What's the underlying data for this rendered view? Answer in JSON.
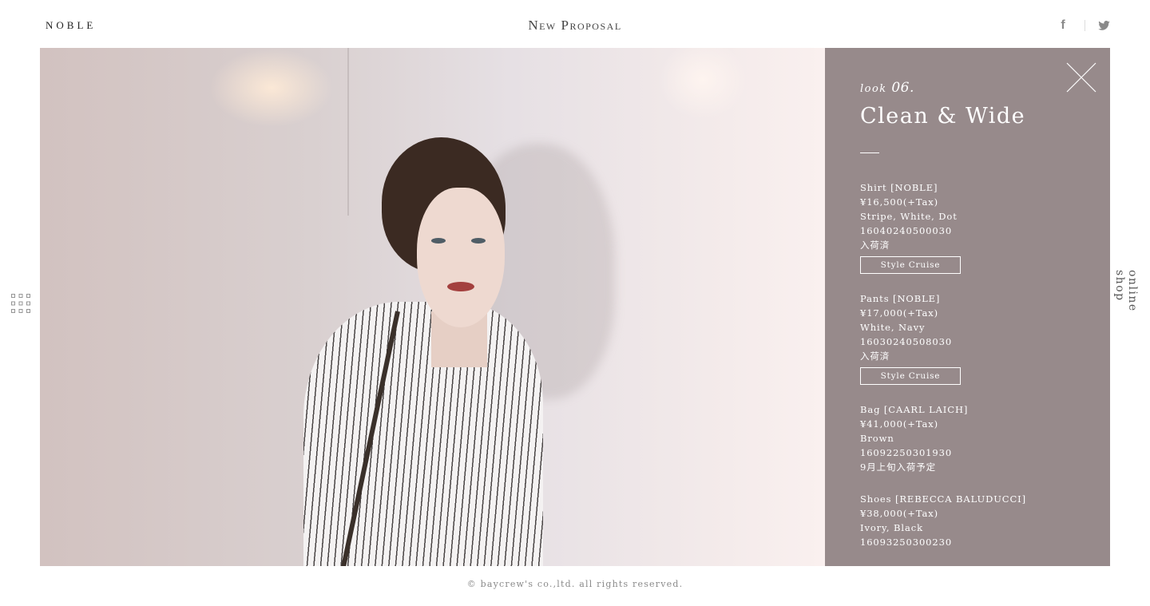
{
  "header": {
    "logo": "NOBLE",
    "title": "New Proposal",
    "social": {
      "facebook_glyph": "f",
      "facebook_icon": "facebook-icon",
      "twitter_icon": "twitter-icon"
    }
  },
  "photo": {
    "alt": "model in striped shirt with brown bag strap"
  },
  "panel": {
    "look_label": "look",
    "look_number": "06.",
    "title": "Clean & Wide",
    "close_icon": "close-icon",
    "items": [
      {
        "name": "Shirt [NOBLE]",
        "price": "¥16,500(+Tax)",
        "colors": "Stripe, White, Dot",
        "code": "16040240500030",
        "status": "入荷済",
        "button": "Style Cruise"
      },
      {
        "name": "Pants [NOBLE]",
        "price": "¥17,000(+Tax)",
        "colors": "White, Navy",
        "code": "16030240508030",
        "status": "入荷済",
        "button": "Style Cruise"
      },
      {
        "name": "Bag [CAARL LAICH]",
        "price": "¥41,000(+Tax)",
        "colors": "Brown",
        "code": "16092250301930",
        "status": "9月上旬入荷予定"
      },
      {
        "name": "Shoes [REBECCA BALUDUCCI]",
        "price": "¥38,000(+Tax)",
        "colors": "Ivory, Black",
        "code": "16093250300230"
      }
    ],
    "background_color": "#978a8b"
  },
  "side": {
    "grid_icon": "grid-icon",
    "online_shop": "online shop"
  },
  "footer": {
    "copyright": "© baycrew's co.,ltd. all rights reserved."
  }
}
